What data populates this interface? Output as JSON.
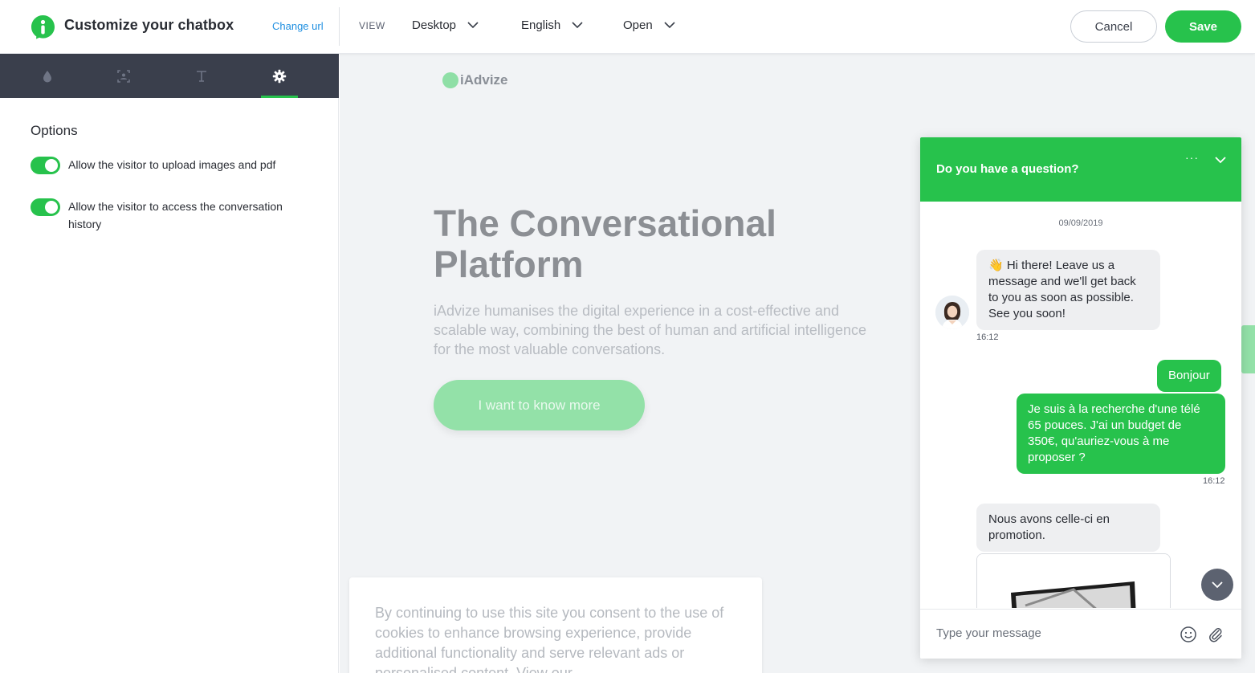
{
  "header": {
    "title": "Customize your chatbox",
    "change_url": "Change url",
    "view_label": "VIEW",
    "device": "Desktop",
    "language": "English",
    "state": "Open",
    "cancel_label": "Cancel",
    "save_label": "Save"
  },
  "sidebar": {
    "tabs": [
      {
        "name": "color",
        "icon": "droplet-icon",
        "active": false
      },
      {
        "name": "image",
        "icon": "image-frame-icon",
        "active": false
      },
      {
        "name": "text",
        "icon": "text-icon",
        "active": false
      },
      {
        "name": "settings",
        "icon": "gear-icon",
        "active": true
      }
    ],
    "options_title": "Options",
    "options": [
      {
        "label": "Allow the visitor to upload images and pdf",
        "enabled": true
      },
      {
        "label": "Allow the visitor to access the conversation history",
        "enabled": true
      }
    ]
  },
  "preview": {
    "site_logo": "iAdvize",
    "hero_title": "The Conversational Platform",
    "hero_text": "iAdvize humanises the digital experience in a cost-effective and scalable way, combining the best of human and artificial intelligence for the most valuable conversations.",
    "hero_button": "I want to know more",
    "cookie_text": "By continuing to use this site you consent to the use of cookies to enhance browsing experience, provide additional functionality and serve relevant ads or personalised content. View our"
  },
  "chatbox": {
    "title": "Do you have a question?",
    "more": "···",
    "date": "09/09/2019",
    "messages": [
      {
        "from": "agent",
        "text": "👋 Hi there! Leave us a message and we'll get back to you as soon as possible. See you soon!",
        "time": "16:12"
      },
      {
        "from": "visitor",
        "text": "Bonjour"
      },
      {
        "from": "visitor",
        "text": "Je suis à la recherche d'une télé 65 pouces. J'ai un budget de 350€, qu'auriez-vous à me proposer ?",
        "time": "16:12"
      },
      {
        "from": "agent",
        "text": "Nous avons celle-ci en promotion."
      }
    ],
    "input_placeholder": "Type your message"
  },
  "colors": {
    "accent": "#27c24c",
    "tabbar": "#3a3f4c",
    "link": "#1f8fe0"
  }
}
